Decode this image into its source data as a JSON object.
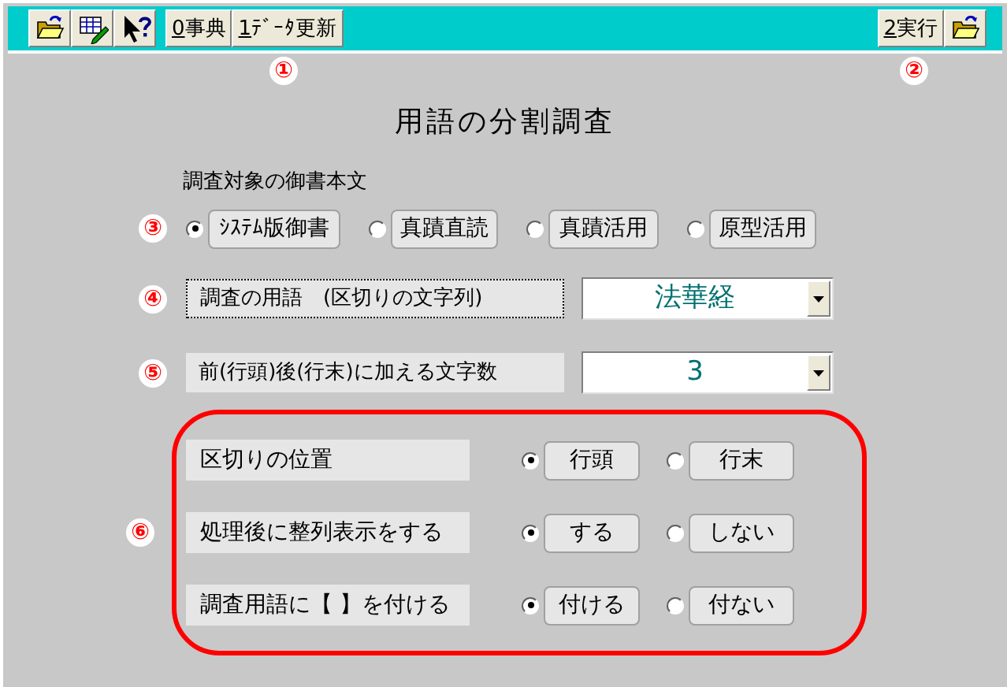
{
  "toolbar": {
    "callout": "①",
    "left_tools": [
      {
        "kind": "icon"
      },
      {
        "kind": "icon"
      },
      {
        "kind": "icon"
      },
      {
        "kind": "text",
        "label": "0事典"
      },
      {
        "kind": "text",
        "label": "1ﾃﾞｰﾀ更新"
      }
    ],
    "right_callout": "②",
    "right_tools": [
      {
        "kind": "text",
        "label": "2実行"
      },
      {
        "kind": "icon"
      }
    ]
  },
  "title": "用語の分割調査",
  "source_text": {
    "label": "調査対象の御書本文",
    "callout": "③",
    "options": [
      {
        "label": "ｼｽﾃﾑ版御書",
        "selected": true
      },
      {
        "label": "真蹟直読",
        "selected": false
      },
      {
        "label": "真蹟活用",
        "selected": false
      },
      {
        "label": "原型活用",
        "selected": false
      }
    ]
  },
  "term": {
    "callout": "④",
    "label": "調査の用語　(区切りの文字列)",
    "value": "法華経"
  },
  "char_count": {
    "callout": "⑤",
    "label": "前(行頭)後(行末)に加える文字数",
    "value": "3"
  },
  "settings": {
    "callout": "⑥",
    "rows": [
      {
        "label": "区切りの位置",
        "options": [
          {
            "label": "行頭",
            "selected": true
          },
          {
            "label": "行末",
            "selected": false
          }
        ]
      },
      {
        "label": "処理後に整列表示をする",
        "options": [
          {
            "label": "する",
            "selected": true
          },
          {
            "label": "しない",
            "selected": false
          }
        ]
      },
      {
        "label": "調査用語に【 】を付ける",
        "options": [
          {
            "label": "付ける",
            "selected": true
          },
          {
            "label": "付ない",
            "selected": false
          }
        ]
      }
    ]
  }
}
